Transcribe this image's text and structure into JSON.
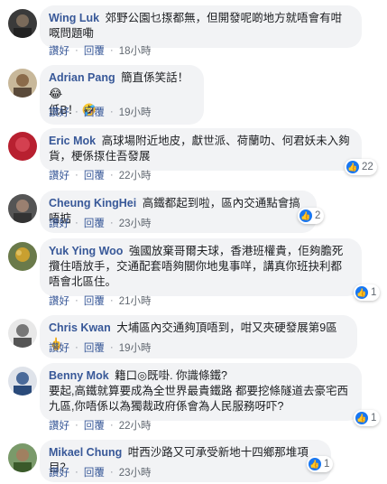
{
  "labels": {
    "like": "讚好",
    "reply": "回覆",
    "sep": "·"
  },
  "comments": [
    {
      "author": "Wing Luk",
      "text": "郊野公園乜揼都無，但開發呢啲地方就唔會有咁嘅問題嘞",
      "time": "18小時",
      "reactions": null
    },
    {
      "author": "Adrian Pang",
      "text": "簡直係笑話！",
      "text2": "低B！",
      "time": "19小時",
      "reactions": null
    },
    {
      "author": "Eric Mok",
      "text": "高球場附近地皮，獻世派、荷蘭叻、何君妖未入夠貨，梗係揼住吾發展",
      "time": "22小時",
      "reactions": "22"
    },
    {
      "author": "Cheung KingHei",
      "text": "高鐵都起到啦，區內交通點會搞唔掂",
      "time": "23小時",
      "reactions": "2"
    },
    {
      "author": "Yuk Ying Woo",
      "text": "強國放棄哥爾夫球，香港班權貴，佢夠膽死攬住唔放手，交通配套唔夠關你地鬼事咩，講真你班抉利都唔會北區住。",
      "time": "21小時",
      "reactions": "1"
    },
    {
      "author": "Chris Kwan",
      "text": "大埔區內交通夠頂唔到，咁又夾硬發展第9區",
      "time": "19小時",
      "reactions": null
    },
    {
      "author": "Benny Mok",
      "text": "籍口◎既啩. 你識條鐵?",
      "text2": "要起,高鐵就算要成為全世界最貴鐵路 都要挖條隧道去豪宅西九區,你唔係以為獨裁政府係會為人民服務呀吓?",
      "time": "22小時",
      "reactions": "1"
    },
    {
      "author": "Mikael Chung",
      "text": "咁西沙路又可承受新地十四鄉那堆項目？",
      "time": "23小時",
      "reactions": "1"
    }
  ]
}
